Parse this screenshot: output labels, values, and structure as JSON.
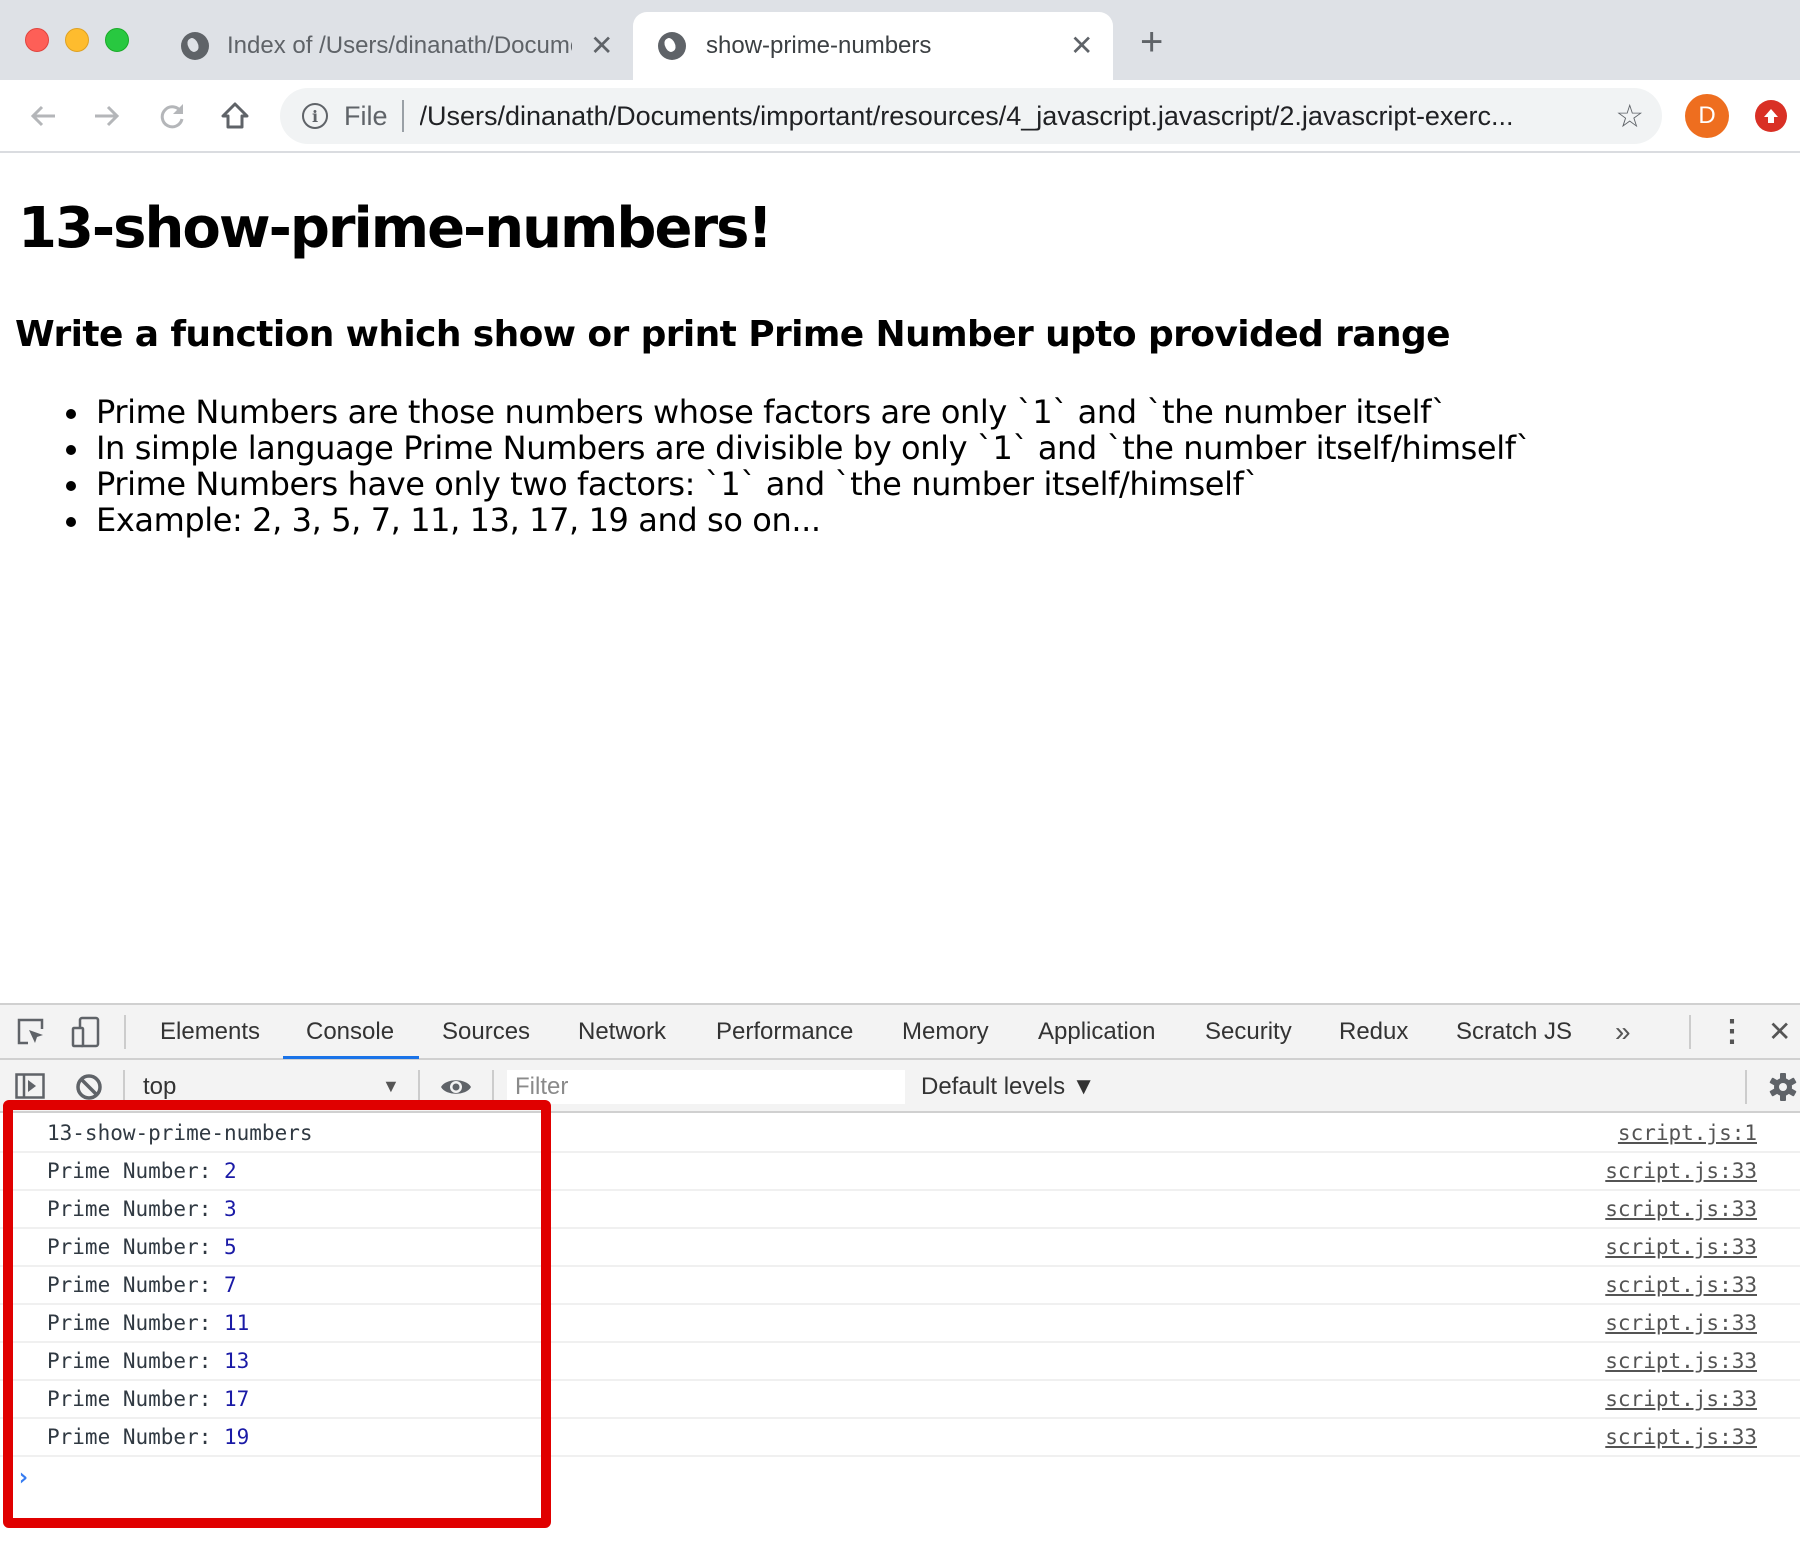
{
  "browser": {
    "tabs": [
      {
        "title": "Index of /Users/dinanath/Documents/important/resources/",
        "favicon": "globe-icon",
        "active": false
      },
      {
        "title": "show-prime-numbers",
        "favicon": "globe-icon",
        "active": true
      }
    ],
    "new_tab_icon": "+",
    "close_icon": "✕",
    "toolbar": {
      "back_icon": "←",
      "forward_icon": "→",
      "reload_icon": "⟳",
      "home_icon": "⌂",
      "info_icon": "i",
      "scheme_label": "File",
      "url": "/Users/dinanath/Documents/important/resources/4_javascript.javascript/2.javascript-exerc...",
      "bookmark_icon": "☆",
      "profile_initial": "D",
      "profile_color": "#ee6e1f",
      "update_color": "#d93025"
    }
  },
  "page": {
    "title": "13-show-prime-numbers!",
    "subtitle": "Write a function which show or print Prime Number upto provided range",
    "points": [
      "Prime Numbers are those numbers whose factors are only `1` and `the number itself`",
      "In simple language Prime Numbers are divisible by only `1` and `the number itself/himself`",
      "Prime Numbers have only two factors: `1` and `the number itself/himself`",
      "Example: 2, 3, 5, 7, 11, 13, 17, 19 and so on..."
    ]
  },
  "devtools": {
    "tabs": [
      "Elements",
      "Console",
      "Sources",
      "Network",
      "Performance",
      "Memory",
      "Application",
      "Security",
      "Redux",
      "Scratch JS"
    ],
    "active_tab": "Console",
    "more_tabs_icon": "»",
    "menu_icon": "⋮",
    "close_icon": "✕",
    "toolbar": {
      "context": "top",
      "context_arrow": "▼",
      "filter_placeholder": "Filter",
      "levels": "Default levels ▼"
    },
    "console": {
      "rows": [
        {
          "label": "13-show-prime-numbers",
          "value": "",
          "source": "script.js:1"
        },
        {
          "label": "Prime Number: ",
          "value": "2",
          "source": "script.js:33"
        },
        {
          "label": "Prime Number: ",
          "value": "3",
          "source": "script.js:33"
        },
        {
          "label": "Prime Number: ",
          "value": "5",
          "source": "script.js:33"
        },
        {
          "label": "Prime Number: ",
          "value": "7",
          "source": "script.js:33"
        },
        {
          "label": "Prime Number: ",
          "value": "11",
          "source": "script.js:33"
        },
        {
          "label": "Prime Number: ",
          "value": "13",
          "source": "script.js:33"
        },
        {
          "label": "Prime Number: ",
          "value": "17",
          "source": "script.js:33"
        },
        {
          "label": "Prime Number: ",
          "value": "19",
          "source": "script.js:33"
        }
      ],
      "prompt": "›",
      "highlight_color": "#e00000"
    }
  }
}
